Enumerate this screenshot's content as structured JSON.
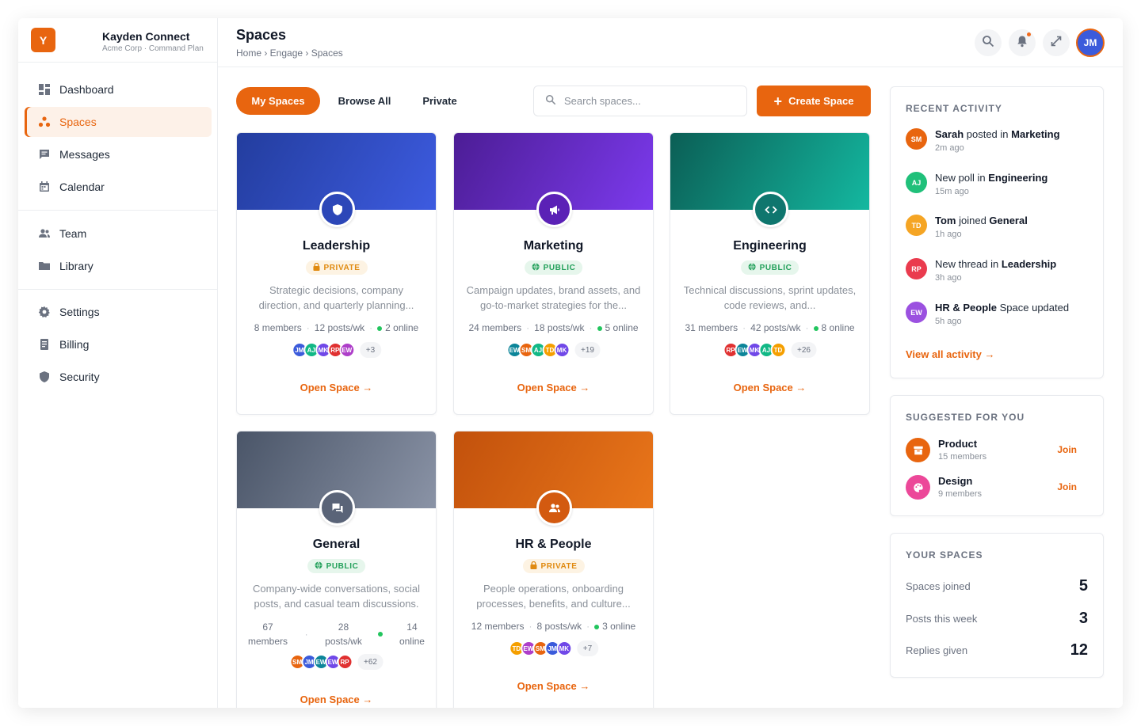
{
  "brand": {
    "logo_letter": "Y",
    "name": "Kayden Connect",
    "subtitle": "Acme Corp · Command Plan"
  },
  "sidebar": {
    "group1": [
      {
        "label": "Dashboard",
        "icon": "dashboard-icon",
        "active": false
      },
      {
        "label": "Spaces",
        "icon": "spaces-icon",
        "active": true
      },
      {
        "label": "Messages",
        "icon": "messages-icon",
        "active": false
      },
      {
        "label": "Calendar",
        "icon": "calendar-icon",
        "active": false
      }
    ],
    "group2": [
      {
        "label": "Team",
        "icon": "team-icon"
      },
      {
        "label": "Library",
        "icon": "folder-icon"
      }
    ],
    "group3": [
      {
        "label": "Settings",
        "icon": "gear-icon"
      },
      {
        "label": "Billing",
        "icon": "billing-icon"
      },
      {
        "label": "Security",
        "icon": "shield-icon"
      }
    ]
  },
  "header": {
    "title": "Spaces",
    "breadcrumb": "Home › Engage › Spaces",
    "avatar": "JM"
  },
  "toolbar": {
    "tabs": [
      "My Spaces",
      "Browse All",
      "Private"
    ],
    "active_tab": 0,
    "search_placeholder": "Search spaces...",
    "create_label": "Create Space"
  },
  "colors": {
    "accent": "#e8650f",
    "online": "#22c55e"
  },
  "spaces": [
    {
      "name": "Leadership",
      "privacy": "PRIVATE",
      "icon": "shield-icon",
      "desc": "Strategic decisions, company direction, and quarterly planning...",
      "members": "8 members",
      "posts": "12 posts/wk",
      "online": "2 online",
      "avatars": [
        "JM",
        "AJ",
        "MK",
        "RP",
        "EW"
      ],
      "more": "+3",
      "open": "Open Space →"
    },
    {
      "name": "Marketing",
      "privacy": "PUBLIC",
      "icon": "megaphone-icon",
      "desc": "Campaign updates, brand assets, and go-to-market strategies for the...",
      "members": "24 members",
      "posts": "18 posts/wk",
      "online": "5 online",
      "avatars": [
        "EW",
        "SM",
        "AJ",
        "TD",
        "MK"
      ],
      "more": "+19",
      "open": "Open Space →"
    },
    {
      "name": "Engineering",
      "privacy": "PUBLIC",
      "icon": "code-icon",
      "desc": "Technical discussions, sprint updates, code reviews, and...",
      "members": "31 members",
      "posts": "42 posts/wk",
      "online": "8 online",
      "avatars": [
        "RP",
        "EW",
        "MK",
        "AJ",
        "TD"
      ],
      "more": "+26",
      "open": "Open Space →"
    },
    {
      "name": "General",
      "privacy": "PUBLIC",
      "icon": "chat-icon",
      "desc": "Company-wide conversations, social posts, and casual team discussions.",
      "members_num": "67",
      "members_word": "members",
      "posts_num": "28",
      "posts_word": "posts/wk",
      "online_num": "14",
      "online_word": "online",
      "avatars": [
        "SM",
        "JM",
        "EW",
        "EW",
        "RP"
      ],
      "more": "+62",
      "open": "Open Space →"
    },
    {
      "name": "HR & People",
      "privacy": "PRIVATE",
      "icon": "people-icon",
      "desc": "People operations, onboarding processes, benefits, and culture...",
      "members": "12 members",
      "posts": "8 posts/wk",
      "online": "3 online",
      "avatars": [
        "TD",
        "EW",
        "SM",
        "JM",
        "MK"
      ],
      "more": "+7",
      "open": "Open Space →"
    }
  ],
  "activity": {
    "title": "RECENT ACTIVITY",
    "items": [
      {
        "avatar": "SM",
        "bold1": "Sarah",
        "mid": " posted in ",
        "bold2": "Marketing",
        "tail": "",
        "time": "2m ago"
      },
      {
        "avatar": "AJ",
        "bold1": "",
        "mid": "New poll in ",
        "bold2": "Engineering",
        "tail": "",
        "time": "15m ago"
      },
      {
        "avatar": "TD",
        "bold1": "Tom",
        "mid": " joined ",
        "bold2": "General",
        "tail": "",
        "time": "1h ago"
      },
      {
        "avatar": "RP",
        "bold1": "",
        "mid": "New thread in ",
        "bold2": "Leadership",
        "tail": "",
        "time": "3h ago"
      },
      {
        "avatar": "EW",
        "bold1": "HR & People",
        "mid": " Space updated",
        "bold2": "",
        "tail": "",
        "time": "5h ago"
      }
    ],
    "view_all": "View all activity →"
  },
  "suggested": {
    "title": "SUGGESTED FOR YOU",
    "items": [
      {
        "name": "Product",
        "meta": "15 members",
        "join": "Join",
        "icon": "box-icon"
      },
      {
        "name": "Design",
        "meta": "9 members",
        "join": "Join",
        "icon": "palette-icon"
      }
    ]
  },
  "your_spaces": {
    "title": "YOUR SPACES",
    "rows": [
      {
        "label": "Spaces joined",
        "value": "5"
      },
      {
        "label": "Posts this week",
        "value": "3"
      },
      {
        "label": "Replies given",
        "value": "12"
      }
    ]
  }
}
